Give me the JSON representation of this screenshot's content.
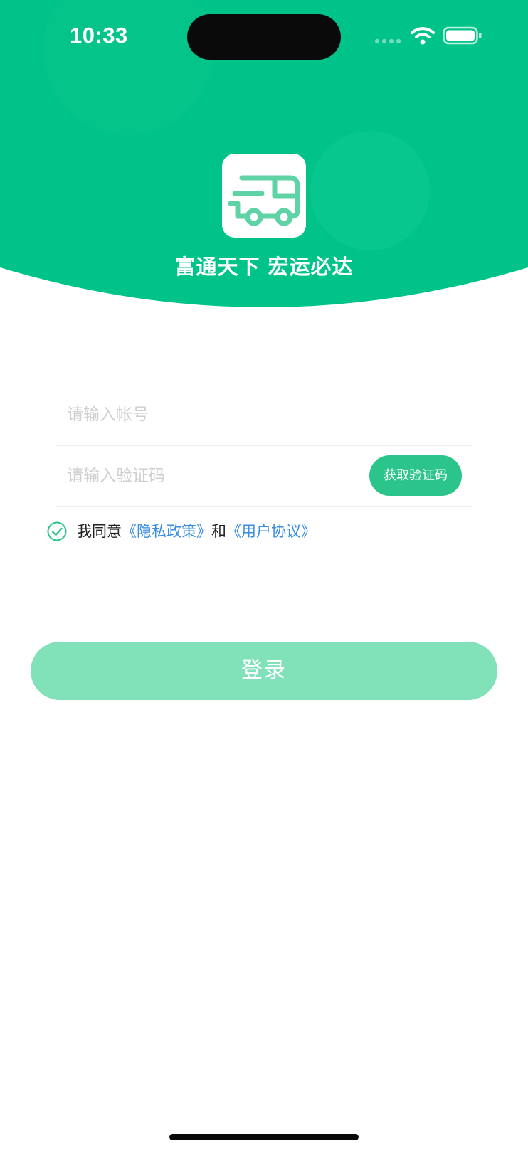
{
  "status_bar": {
    "time": "10:33"
  },
  "header": {
    "slogan": "富通天下 宏运必达",
    "logo_icon": "delivery-truck-icon",
    "colors": {
      "primary": "#00c389",
      "light": "#81e1b9"
    }
  },
  "form": {
    "account_placeholder": "请输入帐号",
    "code_placeholder": "请输入验证码",
    "get_code_label": "获取验证码"
  },
  "agreement": {
    "checked": true,
    "prefix": "我同意",
    "privacy_link": "《隐私政策》",
    "conjunction": "和",
    "user_link": "《用户协议》"
  },
  "login_label": "登录"
}
